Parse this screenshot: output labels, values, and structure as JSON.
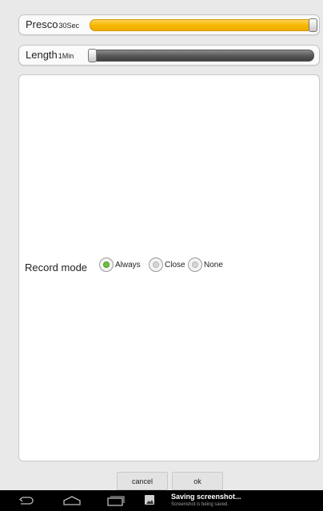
{
  "presco": {
    "label": "Presco",
    "value": "30Sec",
    "level": 1.0
  },
  "length": {
    "label": "Length",
    "value": "1Min",
    "level": 0.0
  },
  "record_mode": {
    "label": "Record mode",
    "options": [
      {
        "label": "Always",
        "selected": true
      },
      {
        "label": "Close",
        "selected": false
      },
      {
        "label": "None",
        "selected": false
      }
    ]
  },
  "buttons": {
    "cancel": "cancel",
    "ok": "ok"
  },
  "notification": {
    "title": "Saving screenshot...",
    "subtitle": "Screenshot is being saved."
  },
  "colors": {
    "accent_fill": "#f8b800",
    "radio_checked": "#6fc13a",
    "navbar": "#000000"
  }
}
